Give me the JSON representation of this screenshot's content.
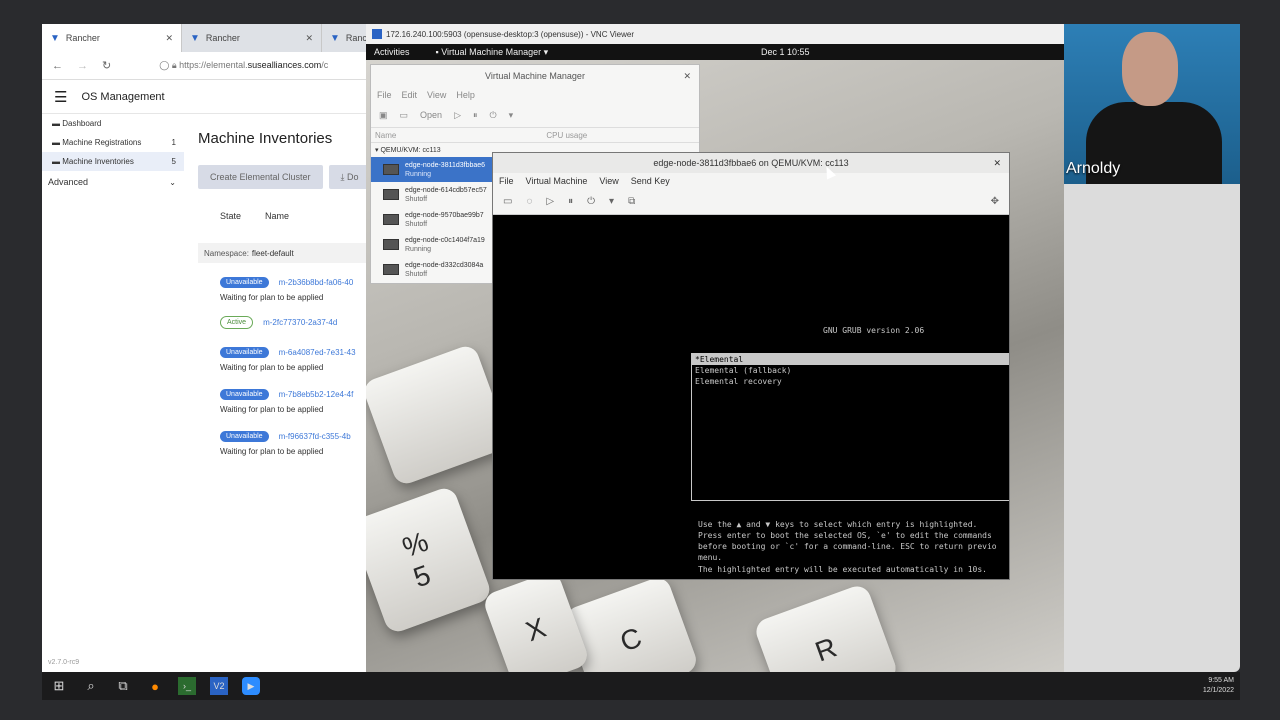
{
  "browser": {
    "tabs": [
      {
        "label": "Rancher",
        "active": true
      },
      {
        "label": "Rancher",
        "active": false
      },
      {
        "label": "Ranch",
        "active": false
      }
    ],
    "url_prefix": "https://elemental.",
    "url_host": "susealliances.com",
    "url_suffix": "/c"
  },
  "rancher": {
    "header_title": "OS Management",
    "sidebar": [
      {
        "label": "Dashboard",
        "count": ""
      },
      {
        "label": "Machine Registrations",
        "count": "1"
      },
      {
        "label": "Machine Inventories",
        "count": "5"
      }
    ],
    "advanced_label": "Advanced",
    "version": "v2.7.0-rc9",
    "page_title": "Machine Inventories",
    "create_button": "Create Elemental Cluster",
    "download_button": "Do",
    "columns": {
      "state": "State",
      "name": "Name"
    },
    "namespace_label": "Namespace:",
    "namespace_value": "fleet-default",
    "machines": [
      {
        "state": "Unavailable",
        "name": "m-2b36b8bd-fa06-40",
        "note": "Waiting for plan to be applied"
      },
      {
        "state": "Active",
        "name": "m-2fc77370-2a37-4d",
        "note": ""
      },
      {
        "state": "Unavailable",
        "name": "m-6a4087ed-7e31-43",
        "note": "Waiting for plan to be applied"
      },
      {
        "state": "Unavailable",
        "name": "m-7b8eb5b2-12e4-4f",
        "note": "Waiting for plan to be applied"
      },
      {
        "state": "Unavailable",
        "name": "m-f96637fd-c355-4b",
        "note": "Waiting for plan to be applied"
      }
    ]
  },
  "vnc": {
    "title": "172.16.240.100:5903 (opensuse-desktop:3 (opensuse)) - VNC Viewer",
    "activities": "Activities",
    "app_menu": "Virtual Machine Manager ▾",
    "clock": "Dec 1  10:55"
  },
  "vmm": {
    "title": "Virtual Machine Manager",
    "menu": [
      "File",
      "Edit",
      "View",
      "Help"
    ],
    "open_label": "Open",
    "col_name": "Name",
    "col_cpu": "CPU usage",
    "connection": "QEMU/KVM: cc113",
    "vms": [
      {
        "name": "edge-node-3811d3fbbae6",
        "status": "Running",
        "selected": true
      },
      {
        "name": "edge-node-614cdb57ec57",
        "status": "Shutoff",
        "selected": false
      },
      {
        "name": "edge-node-9570bae99b7",
        "status": "Shutoff",
        "selected": false
      },
      {
        "name": "edge-node-c0c1404f7a19",
        "status": "Running",
        "selected": false
      },
      {
        "name": "edge-node-d332cd3084a",
        "status": "Shutoff",
        "selected": false
      }
    ]
  },
  "console": {
    "title": "edge-node-3811d3fbbae6 on QEMU/KVM: cc113",
    "menu": [
      "File",
      "Virtual Machine",
      "View",
      "Send Key"
    ],
    "grub_version": "GNU GRUB  version 2.06",
    "entries": [
      "*Elemental",
      "Elemental (fallback)",
      "Elemental recovery"
    ],
    "help_lines": [
      "Use the ▲ and ▼ keys to select which entry is highlighted.",
      "Press enter to boot the selected OS, `e' to edit the commands",
      "before booting or `c' for a command-line. ESC to return previo",
      "menu."
    ],
    "auto_line": "The highlighted entry will be executed automatically in 10s."
  },
  "webcam": {
    "name": "Arnoldy"
  },
  "taskbar": {
    "time": "9:55 AM",
    "date": "12/1/2022"
  }
}
